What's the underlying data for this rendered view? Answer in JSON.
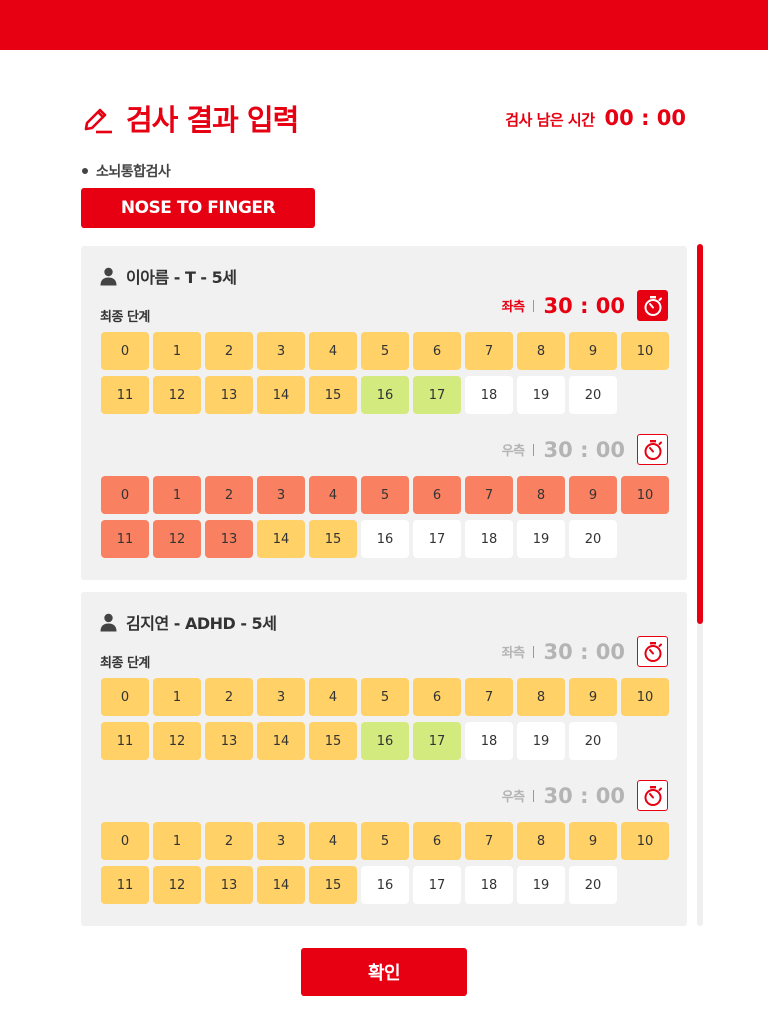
{
  "header": {
    "title": "검사 결과 입력",
    "time_label": "검사 남은 시간",
    "time_value": "00 : 00"
  },
  "subtest_label": "소뇌통합검사",
  "test_name": "NOSE TO FINGER",
  "final_stage_label": "최종 단계",
  "colors": {
    "accent": "#e60012",
    "yellow": "#ffd166",
    "green": "#d3ea7e",
    "red": "#f98162",
    "white": "#ffffff",
    "card": "#f1f1f1"
  },
  "patients": [
    {
      "name": "이아름 - T - 5세",
      "left": {
        "side": "좌측",
        "time": "30 : 00",
        "state": "active",
        "cells": [
          "y",
          "y",
          "y",
          "y",
          "y",
          "y",
          "y",
          "y",
          "y",
          "y",
          "y",
          "y",
          "y",
          "y",
          "y",
          "y",
          "g",
          "g",
          "w",
          "w",
          "w"
        ]
      },
      "right": {
        "side": "우측",
        "time": "30 : 00",
        "state": "inactive",
        "cells": [
          "r",
          "r",
          "r",
          "r",
          "r",
          "r",
          "r",
          "r",
          "r",
          "r",
          "r",
          "r",
          "r",
          "r",
          "y",
          "y",
          "w",
          "w",
          "w",
          "w",
          "w"
        ]
      }
    },
    {
      "name": "김지연 - ADHD - 5세",
      "left": {
        "side": "좌측",
        "time": "30 : 00",
        "state": "inactive",
        "cells": [
          "y",
          "y",
          "y",
          "y",
          "y",
          "y",
          "y",
          "y",
          "y",
          "y",
          "y",
          "y",
          "y",
          "y",
          "y",
          "y",
          "g",
          "g",
          "w",
          "w",
          "w"
        ]
      },
      "right": {
        "side": "우측",
        "time": "30 : 00",
        "state": "inactive",
        "cells": [
          "y",
          "y",
          "y",
          "y",
          "y",
          "y",
          "y",
          "y",
          "y",
          "y",
          "y",
          "y",
          "y",
          "y",
          "y",
          "y",
          "w",
          "w",
          "w",
          "w",
          "w"
        ]
      }
    }
  ],
  "stage_numbers": [
    "0",
    "1",
    "2",
    "3",
    "4",
    "5",
    "6",
    "7",
    "8",
    "9",
    "10",
    "11",
    "12",
    "13",
    "14",
    "15",
    "16",
    "17",
    "18",
    "19",
    "20"
  ],
  "confirm_label": "확인"
}
